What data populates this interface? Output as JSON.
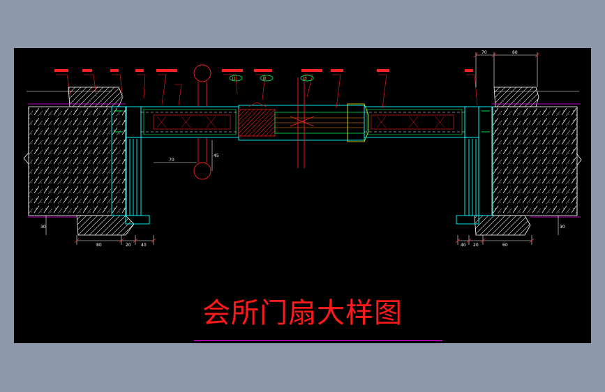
{
  "title": "会所门扇大样图",
  "colors": {
    "background": "#8d99ab",
    "viewport": "#000000",
    "title": "#ff1a1a",
    "accent": "#ff00ff",
    "wall": "#ffffff",
    "frame": "#00ffff",
    "annotation": "#ff2020",
    "glass": "#ff8c00",
    "wood": "#00ff60"
  },
  "dimensions": {
    "top_right_1": "70",
    "top_right_2": "60",
    "bottom_left_1": "80",
    "bottom_left_2": "20",
    "bottom_left_3": "40",
    "bottom_right_1": "40",
    "bottom_right_2": "20",
    "bottom_right_3": "60",
    "left_vertical": "30",
    "right_vertical": "30",
    "handle_offset": "70",
    "leaf_height": "45"
  },
  "codes": {
    "code_1": "J1",
    "code_2": "J2",
    "code_3": "J3"
  }
}
